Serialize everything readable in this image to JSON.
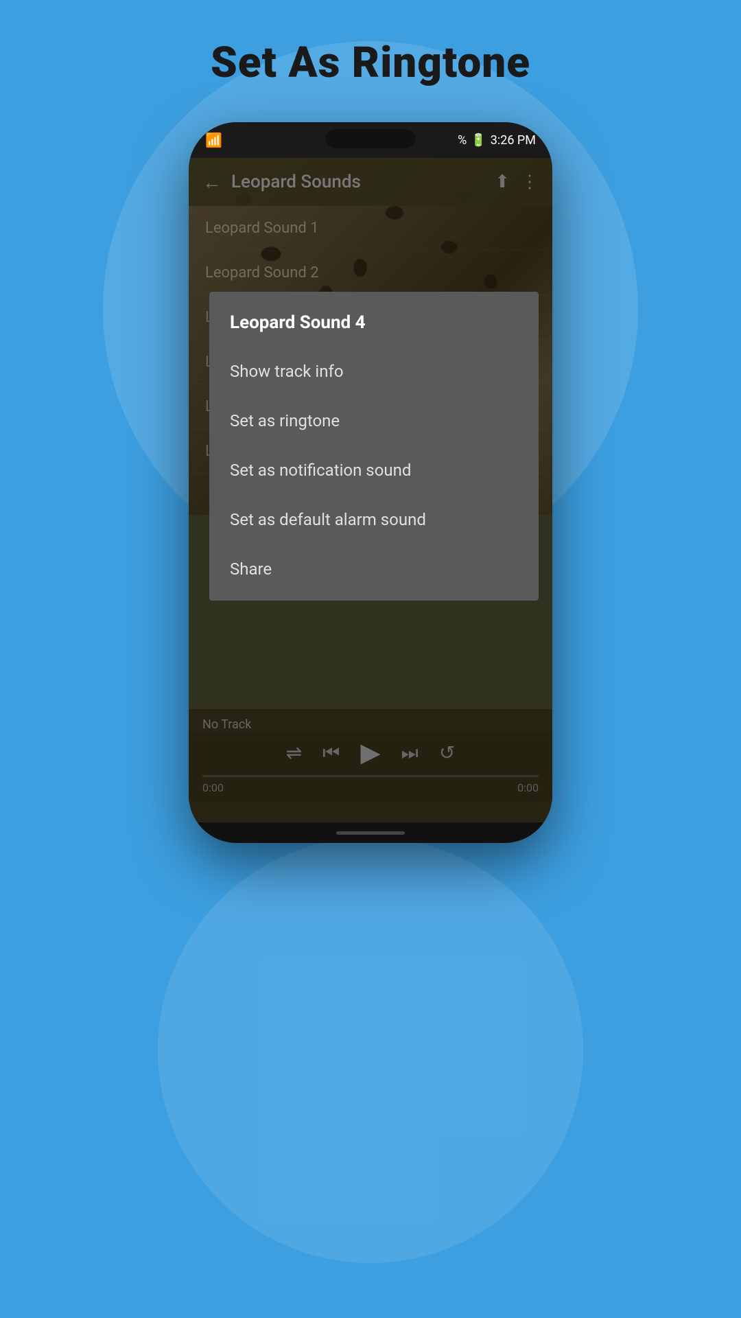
{
  "page": {
    "title": "Set As Ringtone",
    "background_color": "#3d9fe0"
  },
  "status_bar": {
    "battery": "3:26 PM",
    "battery_percent": "%",
    "time": "3:26 PM"
  },
  "app_header": {
    "title": "Leopard Sounds",
    "back_label": "←",
    "share_label": "⬆",
    "more_label": "⋮"
  },
  "track_list": {
    "items": [
      {
        "label": "Leopard Sound 1"
      },
      {
        "label": "Leopard Sound 2"
      },
      {
        "label": "L..."
      },
      {
        "label": "L..."
      },
      {
        "label": "L..."
      },
      {
        "label": "L..."
      }
    ]
  },
  "context_menu": {
    "title": "Leopard Sound 4",
    "items": [
      {
        "id": "show-track-info",
        "label": "Show track info"
      },
      {
        "id": "set-ringtone",
        "label": "Set as ringtone"
      },
      {
        "id": "set-notification",
        "label": "Set as notification sound"
      },
      {
        "id": "set-alarm",
        "label": "Set as default alarm sound"
      },
      {
        "id": "share",
        "label": "Share"
      }
    ]
  },
  "bottom_player": {
    "track_name": "No Track",
    "time_left": "0:00",
    "time_right": "0:00",
    "controls": {
      "shuffle": "⇌",
      "prev": "⏮",
      "play": "▶",
      "next": "⏭",
      "repeat": "↺"
    }
  }
}
